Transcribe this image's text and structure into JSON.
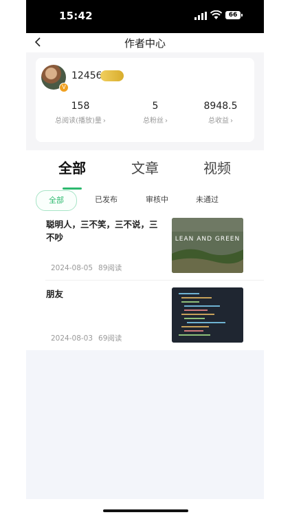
{
  "status_bar": {
    "time": "15:42",
    "battery": "66",
    "icons": [
      "signal-icon",
      "wifi-icon",
      "battery-icon"
    ]
  },
  "nav": {
    "title": "作者中心",
    "back_icon": "back-chevron-icon"
  },
  "profile": {
    "username": "12456",
    "avatar_badge": "V",
    "stats": [
      {
        "value": "158",
        "label": "总阅读(播放)量"
      },
      {
        "value": "5",
        "label": "总粉丝"
      },
      {
        "value": "8948.5",
        "label": "总收益"
      }
    ]
  },
  "tabs": [
    {
      "label": "全部",
      "active": true
    },
    {
      "label": "文章",
      "active": false
    },
    {
      "label": "视频",
      "active": false
    }
  ],
  "filters": [
    {
      "label": "全部",
      "active": true
    },
    {
      "label": "已发布",
      "active": false
    },
    {
      "label": "审核中",
      "active": false
    },
    {
      "label": "未通过",
      "active": false
    }
  ],
  "articles": [
    {
      "title": "聪明人，三不笑，三不说，三不吵",
      "date": "2024-08-05",
      "reads": "89阅读",
      "thumb_text": "LEAN AND GREEN"
    },
    {
      "title": "朋友",
      "date": "2024-08-03",
      "reads": "69阅读"
    }
  ],
  "colors": {
    "accent": "#2cb96e",
    "status_bar_bg": "#000000",
    "badge_gold": "#d8ad2d"
  }
}
